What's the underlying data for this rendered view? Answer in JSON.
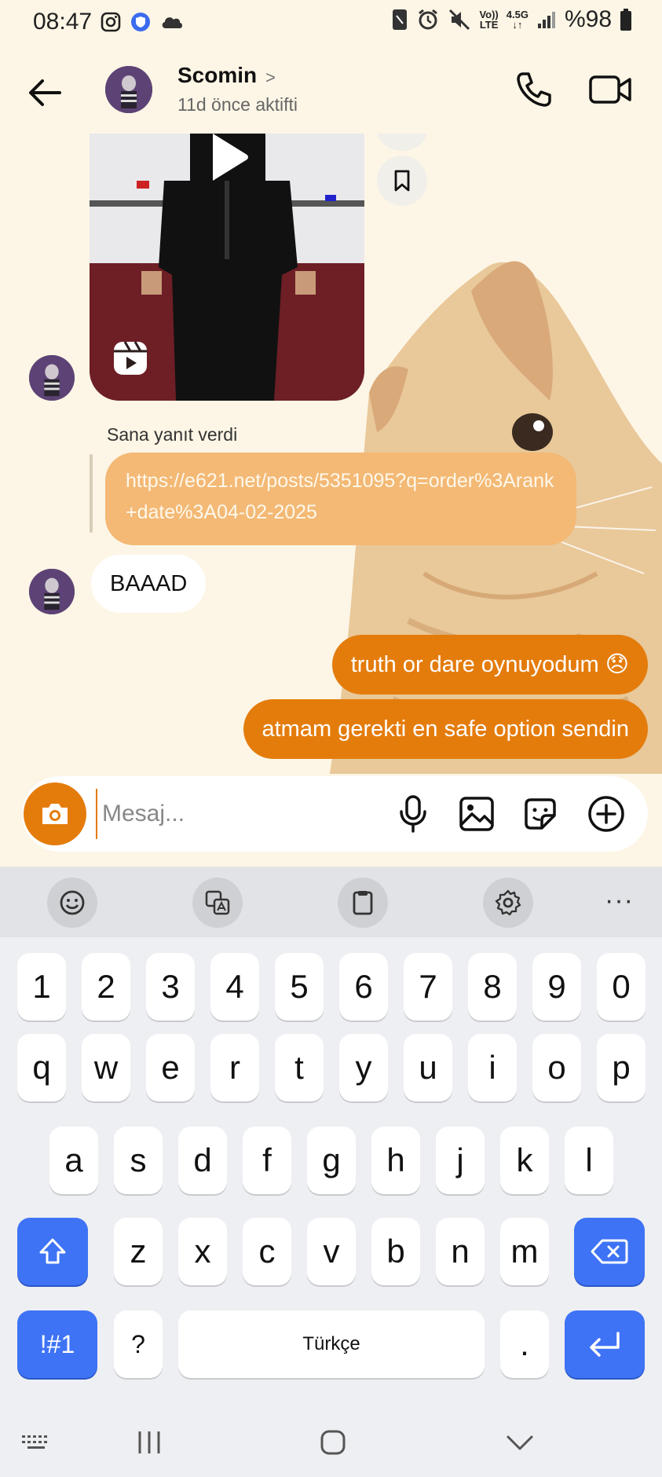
{
  "status_bar": {
    "time": "08:47",
    "network_top": "Vo))",
    "network_bottom": "LTE",
    "data_type": "4.5G",
    "battery": "%98"
  },
  "header": {
    "contact_name": "Scomin",
    "contact_status": "11d önce aktifti"
  },
  "messages": {
    "reply_label": "Sana yanıt verdi",
    "link_text": "https://e621.net/posts/5351095?q=order%3Arank+date%3A04-02-2025",
    "incoming_text": "BAAAD",
    "outgoing": [
      "truth or dare oynuyodum 😞",
      "atmam gerekti en safe option sendin"
    ]
  },
  "composer": {
    "placeholder": "Mesaj..."
  },
  "keyboard": {
    "row_numbers": [
      "1",
      "2",
      "3",
      "4",
      "5",
      "6",
      "7",
      "8",
      "9",
      "0"
    ],
    "row_1": [
      "q",
      "w",
      "e",
      "r",
      "t",
      "y",
      "u",
      "i",
      "o",
      "p"
    ],
    "row_2": [
      "a",
      "s",
      "d",
      "f",
      "g",
      "h",
      "j",
      "k",
      "l"
    ],
    "row_3": [
      "z",
      "x",
      "c",
      "v",
      "b",
      "n",
      "m"
    ],
    "symbols_key": "!#1",
    "question_key": "?",
    "space_label": "Türkçe",
    "period_key": ".",
    "more_label": "···"
  },
  "colors": {
    "accent_orange": "#e47c0c",
    "link_bubble": "#f3b975",
    "keyboard_blue": "#3e73f5",
    "background": "#fdf6e6"
  },
  "icons": [
    "instagram-icon",
    "vpn-icon",
    "cloud-icon",
    "back-arrow-icon",
    "phone-icon",
    "video-icon",
    "play-icon",
    "reels-icon",
    "bookmark-icon",
    "camera-icon",
    "mic-icon",
    "gallery-icon",
    "sticker-icon",
    "plus-icon",
    "emoji-icon",
    "translate-icon",
    "clipboard-icon",
    "settings-icon",
    "shift-icon",
    "backspace-icon",
    "enter-icon",
    "keyboard-hide-icon",
    "recents-icon",
    "home-icon",
    "chevron-down-icon"
  ]
}
